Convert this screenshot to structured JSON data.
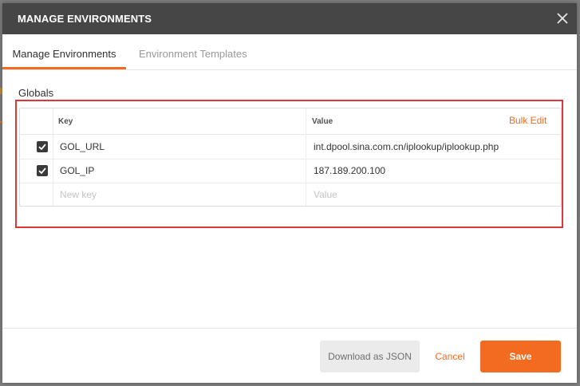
{
  "modal": {
    "title": "MANAGE ENVIRONMENTS",
    "close_icon": "close-icon"
  },
  "tabs": [
    {
      "label": "Manage Environments",
      "active": true
    },
    {
      "label": "Environment Templates",
      "active": false
    }
  ],
  "globals": {
    "section_label": "Globals",
    "table": {
      "headers": {
        "key": "Key",
        "value": "Value"
      },
      "bulk_edit_label": "Bulk Edit",
      "rows": [
        {
          "enabled": true,
          "key": "GOL_URL",
          "value": "int.dpool.sina.com.cn/iplookup/iplookup.php"
        },
        {
          "enabled": true,
          "key": "GOL_IP",
          "value": "187.189.200.100"
        }
      ],
      "new_row": {
        "key_placeholder": "New key",
        "value_placeholder": "Value"
      }
    }
  },
  "footer": {
    "download_label": "Download as JSON",
    "cancel_label": "Cancel",
    "save_label": "Save"
  },
  "colors": {
    "accent": "#f26b21",
    "header_bg": "#464646",
    "highlight_border": "#e0353a",
    "checkbox_bg": "#3a3a3a"
  }
}
